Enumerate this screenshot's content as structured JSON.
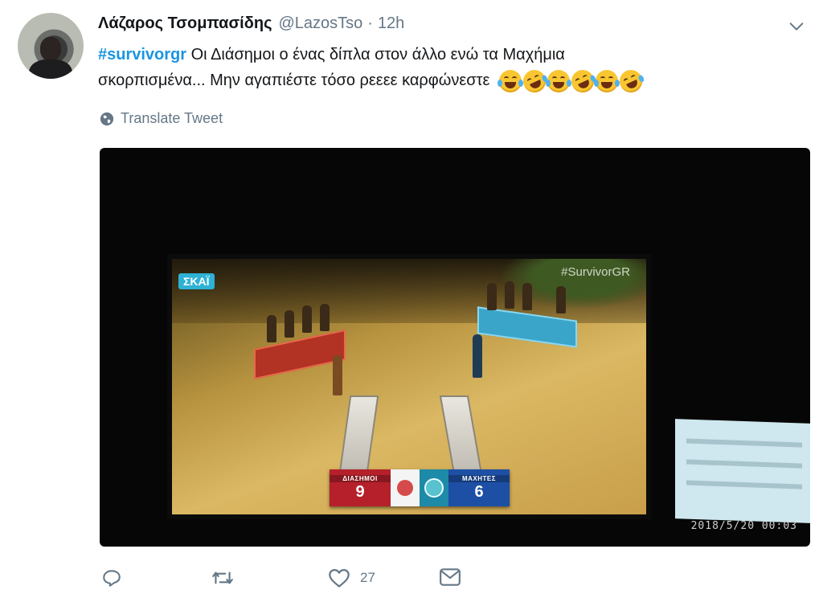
{
  "tweet": {
    "author_name": "Λάζαρος Τσομπασίδης",
    "handle": "@LazosTso",
    "separator": "·",
    "time": "12h",
    "hashtag": "#survivorgr",
    "text_line1": " Οι Διάσημοι ο ένας δίπλα στον άλλο ενώ τα Μαχήμια",
    "text_line2": "σκορπισμένα...  Μην αγαπιέστε τόσο ρεεεε καρφώνεστε",
    "emojis": [
      "joy",
      "rofl",
      "joy",
      "rofl",
      "joy",
      "rofl"
    ],
    "translate_label": "Translate Tweet"
  },
  "media": {
    "channel_logo": "ΣΚΑΪ",
    "watermark": "#SurvivorGR",
    "scoreboard": {
      "team_left": {
        "name": "ΔΙΑΣΗΜΟΙ",
        "score": "9",
        "color": "#b5202a"
      },
      "team_right": {
        "name": "ΜΑΧΗΤΕΣ",
        "score": "6",
        "color": "#1d4fa5"
      }
    },
    "timestamp": "2018/5/20  00:03"
  },
  "actions": {
    "reply_count": "",
    "retweet_count": "",
    "like_count": "27",
    "icons": [
      "reply-icon",
      "retweet-icon",
      "like-icon",
      "message-icon"
    ]
  },
  "colors": {
    "hashtag": "#1b95e0",
    "secondary_text": "#657786",
    "primary_text": "#14171a"
  }
}
